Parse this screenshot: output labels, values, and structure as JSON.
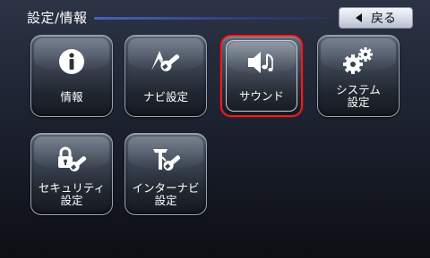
{
  "header": {
    "title": "設定/情報",
    "back_label": "戻る"
  },
  "tiles": [
    {
      "label": "情報",
      "icon": "info-icon"
    },
    {
      "label": "ナビ設定",
      "icon": "navi-wrench-icon"
    },
    {
      "label": "サウンド",
      "icon": "speaker-music-icon",
      "selected": true
    },
    {
      "label": "システム\n設定",
      "icon": "gears-icon"
    },
    {
      "label": "セキュリティ\n設定",
      "icon": "lock-wrench-icon"
    },
    {
      "label": "インターナビ\n設定",
      "icon": "internavi-wrench-icon"
    }
  ],
  "colors": {
    "selection": "#d9242c",
    "header_line": "#4a63b8"
  }
}
